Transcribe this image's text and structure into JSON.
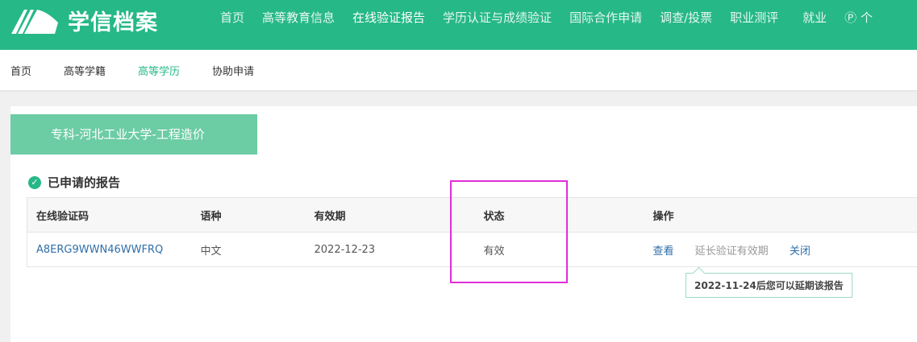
{
  "header": {
    "logo_text": "学信档案",
    "nav": [
      "首页",
      "高等教育信息",
      "在线验证报告",
      "学历认证与成绩验证",
      "国际合作申请",
      "调查/投票",
      "职业测评",
      "就业",
      "个"
    ],
    "active_index": 2
  },
  "subnav": {
    "items": [
      "首页",
      "高等学籍",
      "高等学历",
      "协助申请"
    ],
    "active_index": 2
  },
  "banner": "专科-河北工业大学-工程造价",
  "section_title": "已申请的报告",
  "table": {
    "headers": [
      "在线验证码",
      "语种",
      "有效期",
      "状态",
      "操作"
    ],
    "rows": [
      {
        "code": "A8ERG9WWN46WWFRQ",
        "lang": "中文",
        "expiry": "2022-12-23",
        "status": "有效",
        "actions": [
          "查看",
          "延长验证有效期",
          "关闭"
        ]
      }
    ]
  },
  "tooltip": "2022-11-24后您可以延期该报告",
  "colors": {
    "brand": "#26b887",
    "highlight": "#e02fd6"
  }
}
